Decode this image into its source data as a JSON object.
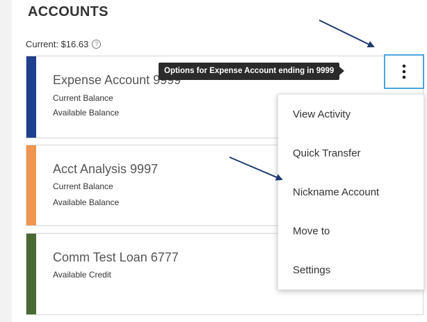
{
  "section": {
    "title": "ACCOUNTS"
  },
  "summary": {
    "current_text": "Current: $16.63",
    "help_icon": "question-circle-icon"
  },
  "accounts": [
    {
      "name": "Expense Account 9999",
      "color": "#1f3f8f",
      "lines": [
        "Current Balance",
        "Available Balance"
      ]
    },
    {
      "name": "Acct Analysis 9997",
      "color": "#f0954f",
      "lines": [
        "Current Balance",
        "Available Balance"
      ]
    },
    {
      "name": "Comm Test Loan 6777",
      "color": "#4a6a33",
      "lines": [
        "Available Credit"
      ]
    }
  ],
  "options_button": {
    "icon": "kebab-vertical-icon",
    "focus_color": "#4aa3e0"
  },
  "tooltip": {
    "text": "Options for Expense Account ending in 9999"
  },
  "menu": {
    "items": [
      "View Activity",
      "Quick Transfer",
      "Nickname Account",
      "Move to",
      "Settings"
    ]
  },
  "annotations": {
    "arrow_color": "#1f3a6e"
  }
}
